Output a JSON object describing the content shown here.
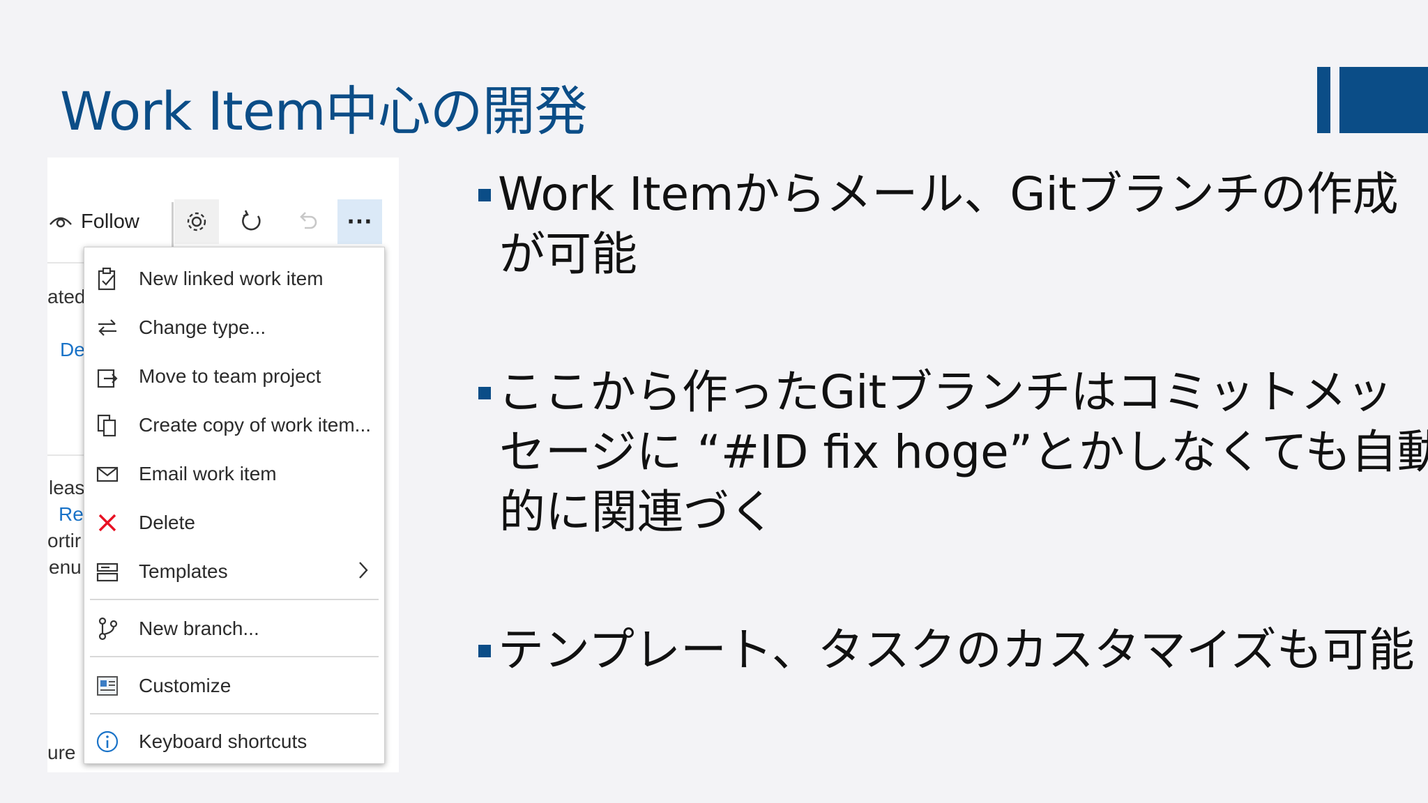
{
  "slide": {
    "title": "Work Item中心の開発",
    "bullets": [
      {
        "lines": [
          "Work Itemからメール、Gitブランチの作成",
          "が可能"
        ]
      },
      {
        "lines": [
          "ここから作ったGitブランチはコミットメッ",
          "セージに “#ID fix hoge”とかしなくても自動",
          "的に関連づく"
        ]
      },
      {
        "lines": [
          "テンプレート、タスクのカスタマイズも可能"
        ]
      }
    ],
    "accent_color": "#0b4d87"
  },
  "screenshot": {
    "toolbar": {
      "follow_label": "Follow",
      "more_label": "···"
    },
    "left_fragments": [
      "ated",
      "De",
      "leas",
      "Re",
      "ortir",
      "enu",
      "ure"
    ],
    "menu": {
      "items": [
        {
          "label": "New linked work item",
          "icon": "clipboard-check-icon"
        },
        {
          "label": "Change type...",
          "icon": "swap-arrows-icon"
        },
        {
          "label": "Move to team project",
          "icon": "move-icon"
        },
        {
          "label": "Create copy of work item...",
          "icon": "copy-icon"
        },
        {
          "label": "Email work item",
          "icon": "mail-icon"
        },
        {
          "label": "Delete",
          "icon": "delete-x-icon",
          "color": "#e81123"
        },
        {
          "label": "Templates",
          "icon": "template-icon",
          "has_submenu": true
        },
        {
          "label": "New branch...",
          "icon": "branch-icon"
        },
        {
          "label": "Customize",
          "icon": "customize-icon"
        },
        {
          "label": "Keyboard shortcuts",
          "icon": "info-icon"
        }
      ]
    }
  }
}
